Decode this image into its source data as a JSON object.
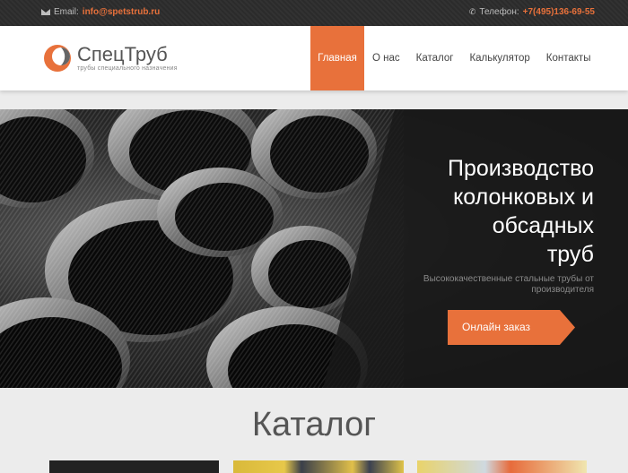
{
  "topbar": {
    "email_label": "Email:",
    "email": "info@spetstrub.ru",
    "phone_label": "Телефон:",
    "phone": "+7(495)136-69-55"
  },
  "header": {
    "logo_name": "СпецТруб",
    "logo_tagline": "трубы специального назначения",
    "nav": [
      {
        "label": "Главная",
        "active": true
      },
      {
        "label": "О нас"
      },
      {
        "label": "Каталог"
      },
      {
        "label": "Калькулятор"
      },
      {
        "label": "Контакты"
      }
    ]
  },
  "hero": {
    "title_lines": [
      "Производство",
      "колонковых и",
      "обсадных",
      "труб"
    ],
    "subtitle": "Высококачественные стальные трубы от производителя",
    "cta": "Онлайн заказ"
  },
  "catalog": {
    "title": "Каталог"
  },
  "colors": {
    "accent": "#e8713b",
    "topbar": "#2b2b2b"
  }
}
